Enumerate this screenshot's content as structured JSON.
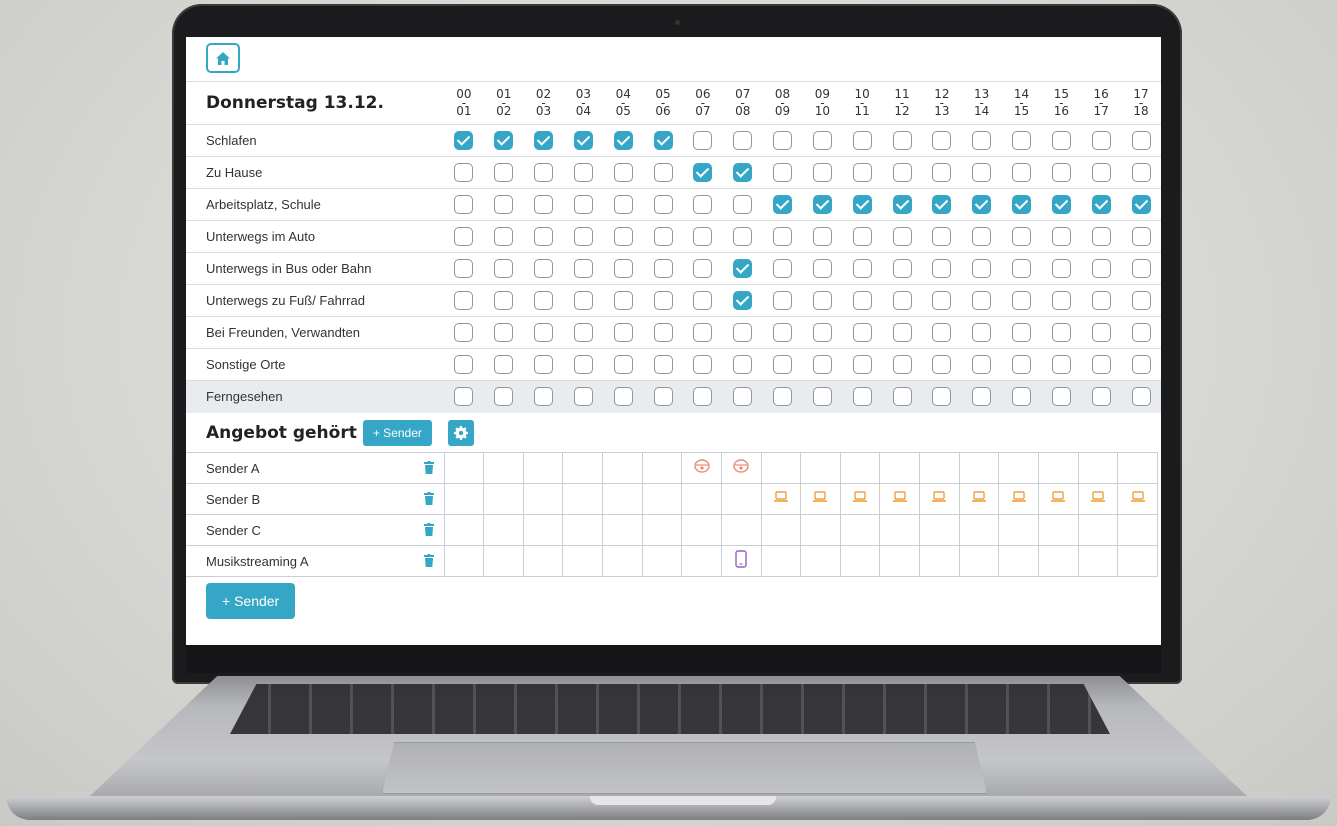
{
  "home_icon": "home-icon",
  "schedule": {
    "day_label": "Donnerstag 13.12.",
    "hours": [
      [
        "00",
        "01"
      ],
      [
        "01",
        "02"
      ],
      [
        "02",
        "03"
      ],
      [
        "03",
        "04"
      ],
      [
        "04",
        "05"
      ],
      [
        "05",
        "06"
      ],
      [
        "06",
        "07"
      ],
      [
        "07",
        "08"
      ],
      [
        "08",
        "09"
      ],
      [
        "09",
        "10"
      ],
      [
        "10",
        "11"
      ],
      [
        "11",
        "12"
      ],
      [
        "12",
        "13"
      ],
      [
        "13",
        "14"
      ],
      [
        "14",
        "15"
      ],
      [
        "15",
        "16"
      ],
      [
        "16",
        "17"
      ],
      [
        "17",
        "18"
      ]
    ],
    "rows": [
      {
        "label": "Schlafen",
        "checked": [
          1,
          1,
          1,
          1,
          1,
          1,
          0,
          0,
          0,
          0,
          0,
          0,
          0,
          0,
          0,
          0,
          0,
          0
        ]
      },
      {
        "label": "Zu Hause",
        "checked": [
          0,
          0,
          0,
          0,
          0,
          0,
          1,
          1,
          0,
          0,
          0,
          0,
          0,
          0,
          0,
          0,
          0,
          0
        ]
      },
      {
        "label": "Arbeitsplatz, Schule",
        "checked": [
          0,
          0,
          0,
          0,
          0,
          0,
          0,
          0,
          1,
          1,
          1,
          1,
          1,
          1,
          1,
          1,
          1,
          1
        ]
      },
      {
        "label": "Unterwegs im Auto",
        "checked": [
          0,
          0,
          0,
          0,
          0,
          0,
          0,
          0,
          0,
          0,
          0,
          0,
          0,
          0,
          0,
          0,
          0,
          0
        ]
      },
      {
        "label": "Unterwegs in Bus oder Bahn",
        "checked": [
          0,
          0,
          0,
          0,
          0,
          0,
          0,
          1,
          0,
          0,
          0,
          0,
          0,
          0,
          0,
          0,
          0,
          0
        ]
      },
      {
        "label": "Unterwegs zu Fuß/ Fahrrad",
        "checked": [
          0,
          0,
          0,
          0,
          0,
          0,
          0,
          1,
          0,
          0,
          0,
          0,
          0,
          0,
          0,
          0,
          0,
          0
        ]
      },
      {
        "label": "Bei Freunden, Verwandten",
        "checked": [
          0,
          0,
          0,
          0,
          0,
          0,
          0,
          0,
          0,
          0,
          0,
          0,
          0,
          0,
          0,
          0,
          0,
          0
        ]
      },
      {
        "label": "Sonstige Orte",
        "checked": [
          0,
          0,
          0,
          0,
          0,
          0,
          0,
          0,
          0,
          0,
          0,
          0,
          0,
          0,
          0,
          0,
          0,
          0
        ]
      },
      {
        "label": "Ferngesehen",
        "checked": [
          0,
          0,
          0,
          0,
          0,
          0,
          0,
          0,
          0,
          0,
          0,
          0,
          0,
          0,
          0,
          0,
          0,
          0
        ],
        "shaded": true
      }
    ]
  },
  "heard": {
    "title": "Angebot gehört",
    "add_sender_small": "+ Sender",
    "settings_icon": "gear-icon",
    "delete_icon": "trash-icon",
    "stations": [
      {
        "name": "Sender A",
        "devices": [
          "",
          "",
          "",
          "",
          "",
          "",
          "radio",
          "radio",
          "",
          "",
          "",
          "",
          "",
          "",
          "",
          "",
          "",
          ""
        ]
      },
      {
        "name": "Sender B",
        "devices": [
          "",
          "",
          "",
          "",
          "",
          "",
          "",
          "",
          "laptop",
          "laptop",
          "laptop",
          "laptop",
          "laptop",
          "laptop",
          "laptop",
          "laptop",
          "laptop",
          "laptop"
        ]
      },
      {
        "name": "Sender C",
        "devices": [
          "",
          "",
          "",
          "",
          "",
          "",
          "",
          "",
          "",
          "",
          "",
          "",
          "",
          "",
          "",
          "",
          "",
          ""
        ]
      },
      {
        "name": "Musikstreaming A",
        "devices": [
          "",
          "",
          "",
          "",
          "",
          "",
          "",
          "smartphone",
          "",
          "",
          "",
          "",
          "",
          "",
          "",
          "",
          "",
          ""
        ]
      }
    ],
    "add_sender_big": "+ Sender"
  },
  "colors": {
    "accent": "#35a6c6",
    "radio": "#e98a72",
    "laptop": "#f0a03c",
    "smartphone": "#9a5fc0"
  }
}
